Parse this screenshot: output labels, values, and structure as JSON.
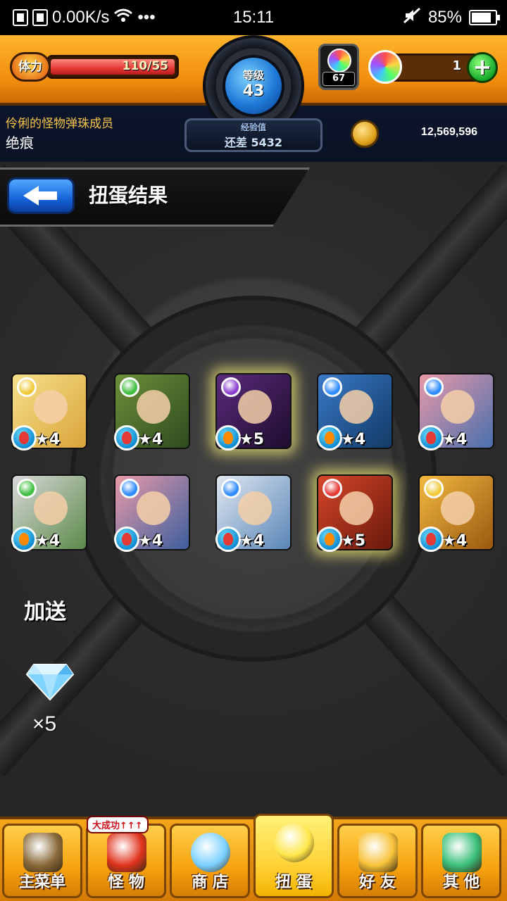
{
  "status_bar": {
    "network_speed": "0.00K/s",
    "dots": "•••",
    "time": "15:11",
    "battery_percent": "85%",
    "battery_level": 0.85
  },
  "header": {
    "stamina_label": "体力",
    "stamina_value": "110/55",
    "stamina_fill": 1.0,
    "level_label": "等级",
    "level": "43",
    "exp_label": "经验值",
    "exp_remaining": "还差 5432",
    "orb_count": "67",
    "gem_count": "1",
    "add_label": "+",
    "player_title": "伶俐的怪物弹珠成员",
    "player_name": "绝痕",
    "coins": "12,569,596"
  },
  "screen": {
    "title": "扭蛋结果"
  },
  "monsters": [
    {
      "stars": "★4",
      "rarity": 4,
      "element": "light",
      "element_color": "#f0c93a",
      "type": "heart",
      "type_color": "#e53935",
      "art": [
        "#f6e08a",
        "#d9a43a"
      ]
    },
    {
      "stars": "★4",
      "rarity": 4,
      "element": "wood",
      "element_color": "#3fbf3f",
      "type": "heart",
      "type_color": "#e53935",
      "art": [
        "#6c8f3a",
        "#2f4a1e"
      ]
    },
    {
      "stars": "★5",
      "rarity": 5,
      "element": "dark",
      "element_color": "#8a3fd1",
      "type": "fire",
      "type_color": "#ff8a00",
      "art": [
        "#5a2a7a",
        "#1e0d2e"
      ]
    },
    {
      "stars": "★4",
      "rarity": 4,
      "element": "water",
      "element_color": "#2d8bff",
      "type": "fire",
      "type_color": "#ff8a00",
      "art": [
        "#3a7ac8",
        "#123a66"
      ]
    },
    {
      "stars": "★4",
      "rarity": 4,
      "element": "water",
      "element_color": "#2d8bff",
      "type": "heart",
      "type_color": "#e53935",
      "art": [
        "#e89aa8",
        "#4a6fae"
      ]
    },
    {
      "stars": "★4",
      "rarity": 4,
      "element": "wood",
      "element_color": "#3fbf3f",
      "type": "fire",
      "type_color": "#ff8a00",
      "art": [
        "#d8d8d8",
        "#5c8a4a"
      ]
    },
    {
      "stars": "★4",
      "rarity": 4,
      "element": "water",
      "element_color": "#2d8bff",
      "type": "heart",
      "type_color": "#e53935",
      "art": [
        "#e89aa8",
        "#3c5f9e"
      ]
    },
    {
      "stars": "★4",
      "rarity": 4,
      "element": "water",
      "element_color": "#2d8bff",
      "type": "heart",
      "type_color": "#e53935",
      "art": [
        "#dfe7f0",
        "#5a86b8"
      ]
    },
    {
      "stars": "★5",
      "rarity": 5,
      "element": "fire",
      "element_color": "#e53935",
      "type": "fire",
      "type_color": "#ff8a00",
      "art": [
        "#d6462a",
        "#6a1a0c"
      ]
    },
    {
      "stars": "★4",
      "rarity": 4,
      "element": "light",
      "element_color": "#f0c93a",
      "type": "heart",
      "type_color": "#e53935",
      "art": [
        "#f2b840",
        "#9a5a10"
      ]
    }
  ],
  "bonus": {
    "label": "加送",
    "item": "diamond",
    "count": "×5"
  },
  "nav": [
    {
      "label": "主菜单",
      "icon": "gate-icon",
      "color": "#8a6a3a",
      "active": false,
      "badge": ""
    },
    {
      "label": "怪 物",
      "icon": "monster-icon",
      "color": "#e0341e",
      "active": false,
      "badge": "大成功↑↑↑"
    },
    {
      "label": "商 店",
      "icon": "orb-icon",
      "color": "#7ad0ff",
      "active": false,
      "badge": ""
    },
    {
      "label": "扭 蛋",
      "icon": "egg-icon",
      "color": "#ffe64a",
      "active": true,
      "badge": ""
    },
    {
      "label": "好 友",
      "icon": "friends-icon",
      "color": "#f7c23a",
      "active": false,
      "badge": ""
    },
    {
      "label": "其 他",
      "icon": "question-icon",
      "color": "#3ac07a",
      "active": false,
      "badge": ""
    }
  ]
}
